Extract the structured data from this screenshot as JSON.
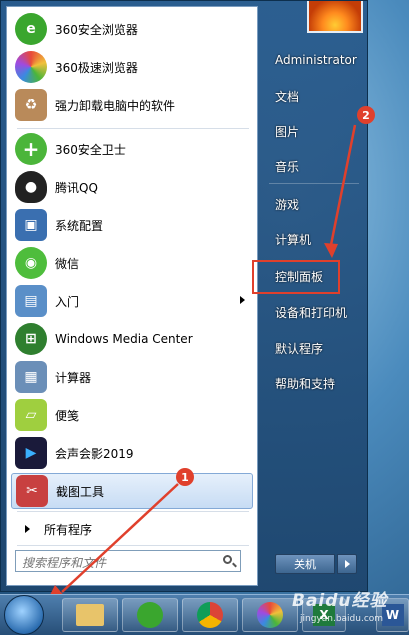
{
  "left_programs": [
    {
      "label": "360安全浏览器",
      "icon": "360-browser-icon",
      "color": "#3aa62e"
    },
    {
      "label": "360极速浏览器",
      "icon": "360-speed-browser-icon",
      "color": "#e8a23a"
    },
    {
      "label": "强力卸载电脑中的软件",
      "icon": "uninstall-box-icon",
      "color": "#b98a5a"
    },
    {
      "label": "360安全卫士",
      "icon": "360-guard-icon",
      "color": "#4bb53a"
    },
    {
      "label": "腾讯QQ",
      "icon": "qq-penguin-icon",
      "color": "#222222"
    },
    {
      "label": "系统配置",
      "icon": "system-config-icon",
      "color": "#3a6fb0"
    },
    {
      "label": "微信",
      "icon": "wechat-icon",
      "color": "#4ebd3c"
    },
    {
      "label": "入门",
      "icon": "getting-started-icon",
      "color": "#5a8fc8"
    },
    {
      "label": "Windows Media Center",
      "icon": "media-center-icon",
      "color": "#2f7f2f"
    },
    {
      "label": "计算器",
      "icon": "calculator-icon",
      "color": "#6b8fb8"
    },
    {
      "label": "便笺",
      "icon": "sticky-notes-icon",
      "color": "#9fcf3f"
    },
    {
      "label": "会声会影2019",
      "icon": "videostudio-icon",
      "color": "#1a1a3a"
    },
    {
      "label": "截图工具",
      "icon": "snipping-tool-icon",
      "color": "#c84040"
    }
  ],
  "all_programs_label": "所有程序",
  "search_placeholder": "搜索程序和文件",
  "right_links": {
    "user": "Administrator",
    "documents": "文档",
    "pictures": "图片",
    "music": "音乐",
    "games": "游戏",
    "computer": "计算机",
    "control_panel": "控制面板",
    "devices": "设备和打印机",
    "default_programs": "默认程序",
    "help": "帮助和支持"
  },
  "shutdown_label": "关机",
  "annotations": {
    "badge1": "1",
    "badge2": "2",
    "accent": "#e0402c"
  },
  "watermark": {
    "main": "Baidu经验",
    "sub": "jingyan.baidu.com"
  }
}
